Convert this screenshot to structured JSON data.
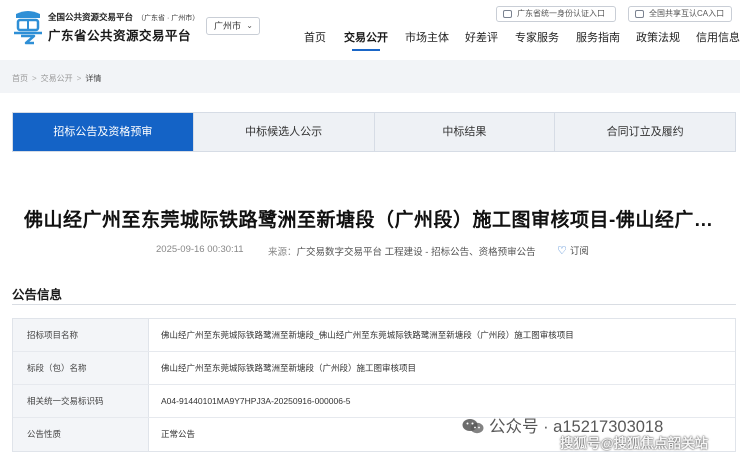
{
  "header": {
    "platform_line1": "全国公共资源交易平台",
    "platform_line1_sub": "（广东省 · 广州市）",
    "platform_line2": "广东省公共资源交易平台",
    "city_select": "广州市",
    "top_buttons": [
      "广东省统一身份认证入口",
      "全国共享互认CA入口"
    ],
    "nav": [
      "首页",
      "交易公开",
      "市场主体",
      "好差评",
      "专家服务",
      "服务指南",
      "政策法规",
      "信用信息"
    ],
    "nav_active": "交易公开"
  },
  "breadcrumb": [
    "首页",
    "交易公开",
    "详情"
  ],
  "tabs": [
    "招标公告及资格预审",
    "中标候选人公示",
    "中标结果",
    "合同订立及履约"
  ],
  "article": {
    "title": "佛山经广州至东莞城际铁路鹭洲至新塘段（广州段）施工图审核项目-佛山经广州至东莞城际铁路鹭洲至新塘段（广州段）施工图审核项目",
    "datetime": "2025-09-16 00:30:11",
    "source_label": "来源：",
    "source_value": "广交易数字交易平台 工程建设 - 招标公告、资格预审公告",
    "subscribe": "订阅"
  },
  "section": {
    "title": "公告信息",
    "rows": [
      {
        "label": "招标项目名称",
        "value": "佛山经广州至东莞城际铁路鹭洲至新塘段_佛山经广州至东莞城际铁路鹭洲至新塘段（广州段）施工图审核项目"
      },
      {
        "label": "标段（包）名称",
        "value": "佛山经广州至东莞城际铁路鹭洲至新塘段（广州段）施工图审核项目"
      },
      {
        "label": "相关统一交易标识码",
        "value": "A04-91440101MA9Y7HPJ3A-20250916-000006-5"
      },
      {
        "label": "公告性质",
        "value": "正常公告"
      }
    ]
  },
  "watermark": {
    "line1": "公众号 · a15217303018",
    "line2": "搜狐号@搜狐焦点韶关站"
  },
  "colors": {
    "accent": "#1463c6",
    "tab_bg": "#eef1f5",
    "label_bg": "#f3f5f8"
  }
}
